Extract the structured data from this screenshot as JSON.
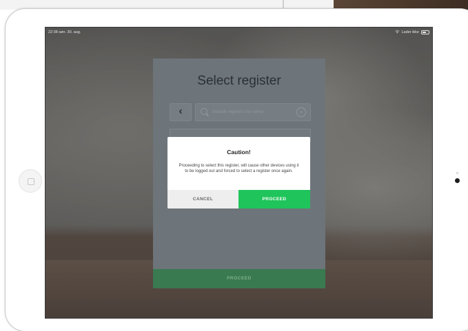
{
  "status_bar": {
    "time": "22:38  søn. 30. aug.",
    "wifi_icon": "wifi-icon",
    "battery_text": "Lader ikke",
    "battery_icon": "battery-icon"
  },
  "panel": {
    "title": "Select register",
    "back_icon": "chevron-left-icon",
    "back_glyph": "‹",
    "search": {
      "placeholder": "Search registers by name",
      "search_icon": "search-icon",
      "clear_icon": "close-circle-icon",
      "clear_glyph": "×"
    },
    "proceed_label": "PROCEED"
  },
  "dialog": {
    "title": "Caution!",
    "message": "Proceeding to select this register, will cause other devices using it to be logged out and forced to select a register once again.",
    "cancel_label": "CANCEL",
    "proceed_label": "PROCEED"
  },
  "colors": {
    "proceed_green": "#1fc45b",
    "panel_proceed_green": "#3a7a50",
    "panel_bg": "#6d747a"
  }
}
